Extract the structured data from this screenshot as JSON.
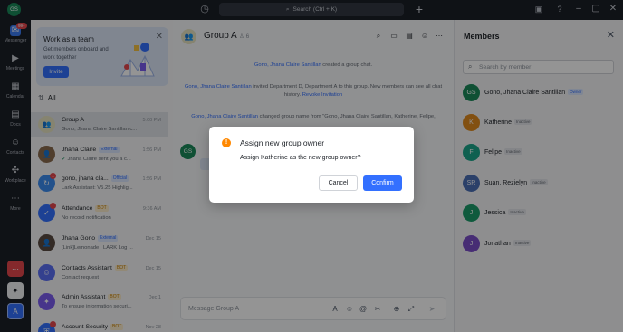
{
  "topbar": {
    "avatar_initials": "GS",
    "search_label": "Search (Ctrl + K)"
  },
  "rail": {
    "messenger_label": "Messenger",
    "messenger_badge": "99+",
    "meetings_label": "Meetings",
    "calendar_label": "Calendar",
    "docs_label": "Docs",
    "contacts_label": "Contacts",
    "workplace_label": "Workplace",
    "more_label": "More",
    "account_initial": "A"
  },
  "banner": {
    "title": "Work as a team",
    "subtitle": "Get members onboard and work together",
    "invite_label": "Invite"
  },
  "list": {
    "filter_label": "All",
    "items": [
      {
        "name": "Group A",
        "tag": "",
        "time": "5:00 PM",
        "preview": "Gono, Jhana Claire Santillan c...",
        "avatar": "GA",
        "color": "#e7e3c2"
      },
      {
        "name": "Jhana Claire",
        "tag": "External",
        "time": "1:56 PM",
        "preview": "Jhana Claire sent you a c...",
        "avatar": "JC",
        "color": "#8a6b4f"
      },
      {
        "name": "gono, jhana cla...",
        "tag": "Official",
        "time": "1:56 PM",
        "preview": "Lark Assistant: V5.25 Highlig...",
        "avatar": "L",
        "color": "#3b8cf0",
        "badge": "1"
      },
      {
        "name": "Attendance",
        "tag": "BOT",
        "time": "9:36 AM",
        "preview": "No record notification",
        "avatar": "A",
        "color": "#3370ff"
      },
      {
        "name": "Jhana Gono",
        "tag": "External",
        "time": "Dec 15",
        "preview": "[Link]Lemonade | LARK Log ...",
        "avatar": "JG",
        "color": "#5b4a42"
      },
      {
        "name": "Contacts Assistant",
        "tag": "BOT",
        "time": "Dec 15",
        "preview": "Contact request",
        "avatar": "C",
        "color": "#5b6ef5"
      },
      {
        "name": "Admin Assistant",
        "tag": "BOT",
        "time": "Dec 1",
        "preview": "To ensure information securi...",
        "avatar": "A",
        "color": "#7b5cf0"
      },
      {
        "name": "Account Security",
        "tag": "BOT",
        "time": "Nov 28",
        "preview": "",
        "avatar": "S",
        "color": "#3370ff"
      }
    ]
  },
  "chat": {
    "title": "Group A",
    "member_count": "6",
    "system_messages": {
      "created_actor": "Gono, Jhana Claire Santillan",
      "created_text": " created a group chat.",
      "invited_actor": "Gono, Jhana Claire Santillan",
      "invited_text": " invited Department D, Department A to this group. New members can see all chat history. ",
      "revoke_label": "Revoke Invitation",
      "renamed_actor": "Gono, Jhana Claire Santillan",
      "renamed_text": " changed group name from \"Gono, Jhana Claire Santillan, Katherine, Felipe,"
    },
    "message_avatar": "GS",
    "composer_placeholder": "Message Group A"
  },
  "members": {
    "title": "Members",
    "search_placeholder": "Search by member",
    "list": [
      {
        "name": "Gono, Jhana Claire Santillan",
        "tag": "Owner",
        "avatar": "GS",
        "color": "#1a8b5b"
      },
      {
        "name": "Katherine",
        "tag": "Inactive",
        "avatar": "K",
        "color": "#e08a1e"
      },
      {
        "name": "Felipe",
        "tag": "Inactive",
        "avatar": "F",
        "color": "#1aa58a"
      },
      {
        "name": "Suan, Rezielyn",
        "tag": "Inactive",
        "avatar": "SR",
        "color": "#4a6fb5"
      },
      {
        "name": "Jessica",
        "tag": "Inactive",
        "avatar": "J",
        "color": "#1a9c6a"
      },
      {
        "name": "Jonathan",
        "tag": "Inactive",
        "avatar": "J",
        "color": "#7a4fc9"
      }
    ]
  },
  "modal": {
    "icon": "!",
    "title": "Assign new group owner",
    "body": "Assign Katherine as the new group owner?",
    "cancel_label": "Cancel",
    "confirm_label": "Confirm"
  }
}
